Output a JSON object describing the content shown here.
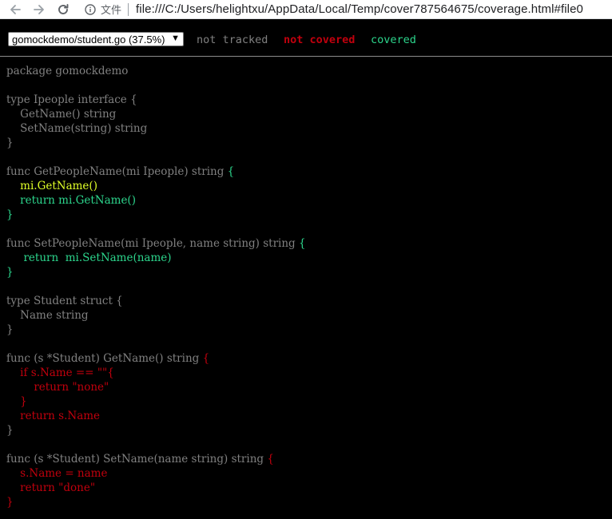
{
  "browser": {
    "scheme_label": "文件",
    "url": "file:///C:/Users/helightxu/AppData/Local/Temp/cover787564675/coverage.html#file0"
  },
  "topbar": {
    "file_selected": "gomockdemo/student.go (37.5%)",
    "legend": {
      "not_tracked": "not tracked",
      "not_covered": "not covered",
      "covered": "covered"
    }
  },
  "colors": {
    "not_tracked": "#808080",
    "not_covered": "#c0000d",
    "covered": "#2cd58c",
    "background": "#000000"
  },
  "code_lines": [
    [
      {
        "t": "package gomockdemo",
        "c": 0
      }
    ],
    [
      {
        "t": "",
        "c": 0
      }
    ],
    [
      {
        "t": "type Ipeople interface {",
        "c": 0
      }
    ],
    [
      {
        "t": "    GetName() string",
        "c": 0
      }
    ],
    [
      {
        "t": "    SetName(string) string",
        "c": 0
      }
    ],
    [
      {
        "t": "}",
        "c": 0
      }
    ],
    [
      {
        "t": "",
        "c": 0
      }
    ],
    [
      {
        "t": "func GetPeopleName(mi Ipeople) string ",
        "c": 0
      },
      {
        "t": "{",
        "c": 2
      }
    ],
    [
      {
        "t": "    mi.GetName()",
        "c": 3
      }
    ],
    [
      {
        "t": "    return mi.GetName()",
        "c": 2
      }
    ],
    [
      {
        "t": "}",
        "c": 2
      }
    ],
    [
      {
        "t": "",
        "c": 0
      }
    ],
    [
      {
        "t": "func SetPeopleName(mi Ipeople, name string) string ",
        "c": 0
      },
      {
        "t": "{",
        "c": 2
      }
    ],
    [
      {
        "t": "     return  mi.SetName(name)",
        "c": 2
      }
    ],
    [
      {
        "t": "}",
        "c": 2
      }
    ],
    [
      {
        "t": "",
        "c": 0
      }
    ],
    [
      {
        "t": "type Student struct {",
        "c": 0
      }
    ],
    [
      {
        "t": "    Name string",
        "c": 0
      }
    ],
    [
      {
        "t": "}",
        "c": 0
      }
    ],
    [
      {
        "t": "",
        "c": 0
      }
    ],
    [
      {
        "t": "func (s *Student) GetName() string ",
        "c": 0
      },
      {
        "t": "{",
        "c": 1
      }
    ],
    [
      {
        "t": "    if s.Name == \"\"{",
        "c": 1
      }
    ],
    [
      {
        "t": "        return \"none\"",
        "c": 1
      }
    ],
    [
      {
        "t": "    }",
        "c": 1
      }
    ],
    [
      {
        "t": "    return s.Name",
        "c": 1
      }
    ],
    [
      {
        "t": "}",
        "c": 0
      }
    ],
    [
      {
        "t": "",
        "c": 0
      }
    ],
    [
      {
        "t": "func (s *Student) SetName(name string) string ",
        "c": 0
      },
      {
        "t": "{",
        "c": 1
      }
    ],
    [
      {
        "t": "    s.Name = name",
        "c": 1
      }
    ],
    [
      {
        "t": "    return \"done\"",
        "c": 1
      }
    ],
    [
      {
        "t": "}",
        "c": 1
      }
    ]
  ]
}
